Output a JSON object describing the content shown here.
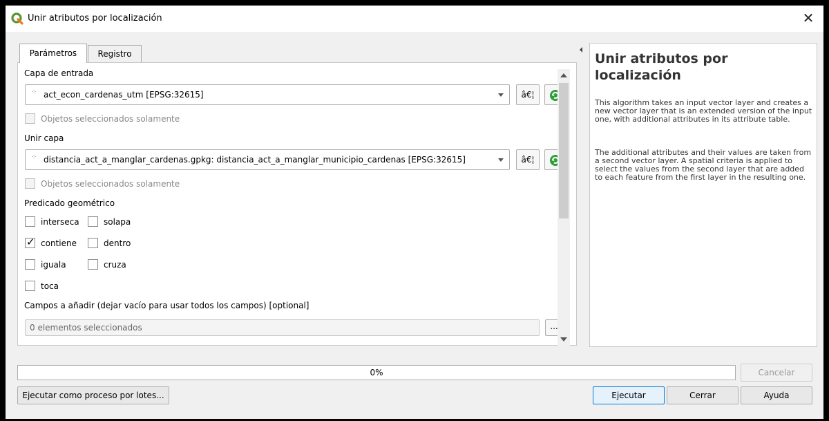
{
  "window": {
    "title": "Unir atributos por localización",
    "close_glyph": "✕"
  },
  "tabs": [
    {
      "label": "Parámetros"
    },
    {
      "label": "Registro"
    }
  ],
  "params": {
    "input_layer": {
      "label": "Capa de entrada",
      "value": "act_econ_cardenas_utm [EPSG:32615]",
      "selected_only_label": "Objetos seleccionados solamente",
      "ellipsis_label": "â€¦"
    },
    "join_layer": {
      "label": "Unir capa",
      "value": "distancia_act_a_manglar_cardenas.gpkg: distancia_act_a_manglar_municipio_cardenas [EPSG:32615]",
      "selected_only_label": "Objetos seleccionados solamente",
      "ellipsis_label": "â€¦"
    },
    "predicate": {
      "label": "Predicado geométrico",
      "options": [
        {
          "label": "interseca",
          "checked": false
        },
        {
          "label": "solapa",
          "checked": false
        },
        {
          "label": "contiene",
          "checked": true
        },
        {
          "label": "dentro",
          "checked": false
        },
        {
          "label": "iguala",
          "checked": false
        },
        {
          "label": "cruza",
          "checked": false
        },
        {
          "label": "toca",
          "checked": false
        }
      ],
      "check_glyph": "✓"
    },
    "fields": {
      "label": "Campos a añadir (dejar vacío para usar todos los campos) [optional]",
      "value": "0 elementos seleccionados",
      "button_label": "..."
    }
  },
  "help": {
    "title": "Unir atributos por localización",
    "paragraph1": "This algorithm takes an input vector layer and creates a new vector layer that is an extended version of the input one, with additional attributes in its attribute table.",
    "paragraph2": "The additional attributes and their values are taken from a second vector layer. A spatial criteria is applied to select the values from the second layer that are added to each feature from the first layer in the resulting one."
  },
  "progress": {
    "value": 0,
    "label": "0%"
  },
  "buttons": {
    "cancel": "Cancelar",
    "batch": "Ejecutar como proceso por lotes...",
    "run": "Ejecutar",
    "close": "Cerrar",
    "help": "Ayuda"
  },
  "colors": {
    "qgis_green": "#589632",
    "refresh_green": "#2e9e3a"
  }
}
